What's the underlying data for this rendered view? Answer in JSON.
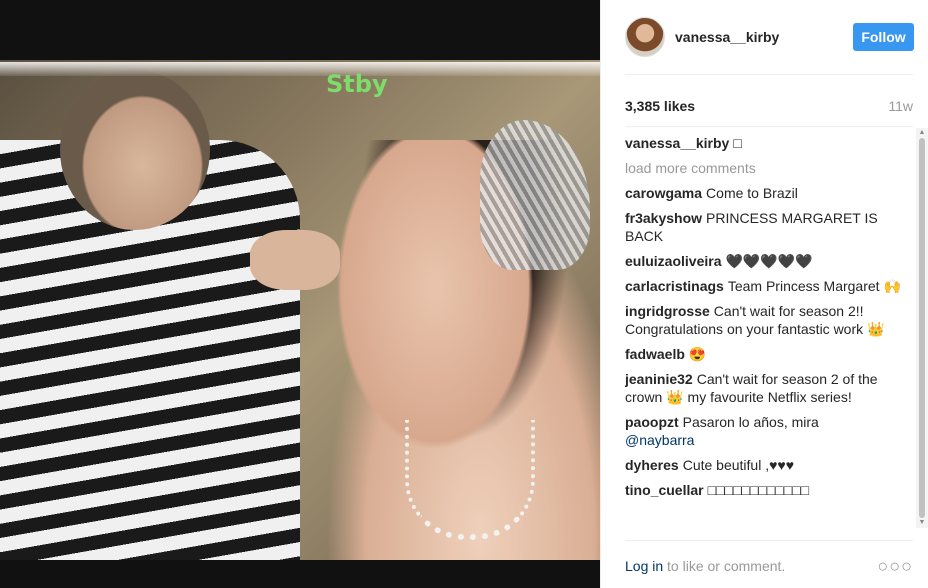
{
  "photo": {
    "overlay_text": "Stby"
  },
  "header": {
    "username": "vanessa__kirby",
    "follow_label": "Follow"
  },
  "stats": {
    "likes": "3,385 likes",
    "age": "11w"
  },
  "caption": {
    "user": "vanessa__kirby",
    "text": "□"
  },
  "load_more": "load more comments",
  "comments": [
    {
      "user": "carowgama",
      "text": "Come to Brazil"
    },
    {
      "user": "fr3akyshow",
      "text": "PRINCESS MARGARET IS BACK"
    },
    {
      "user": "euluizaoliveira",
      "text": "🖤🖤🖤🖤🖤"
    },
    {
      "user": "carlacristinags",
      "text": "Team Princess Margaret 🙌"
    },
    {
      "user": "ingridgrosse",
      "text": "Can't wait for season 2!! Congratulations on your fantastic work 👑"
    },
    {
      "user": "fadwaelb",
      "text": "😍"
    },
    {
      "user": "jeaninie32",
      "text": "Can't wait for season 2 of the crown 👑 my favourite Netflix series!"
    },
    {
      "user": "paoopzt",
      "text": "Pasaron lo años, mira",
      "mention": "@naybarra"
    },
    {
      "user": "dyheres",
      "text": "Cute beutiful ,♥♥♥"
    },
    {
      "user": "tino_cuellar",
      "text": "□□□□□□□□□□□□"
    }
  ],
  "footer": {
    "login_link": "Log in",
    "login_rest": " to like or comment.",
    "more_label": "○○○"
  }
}
